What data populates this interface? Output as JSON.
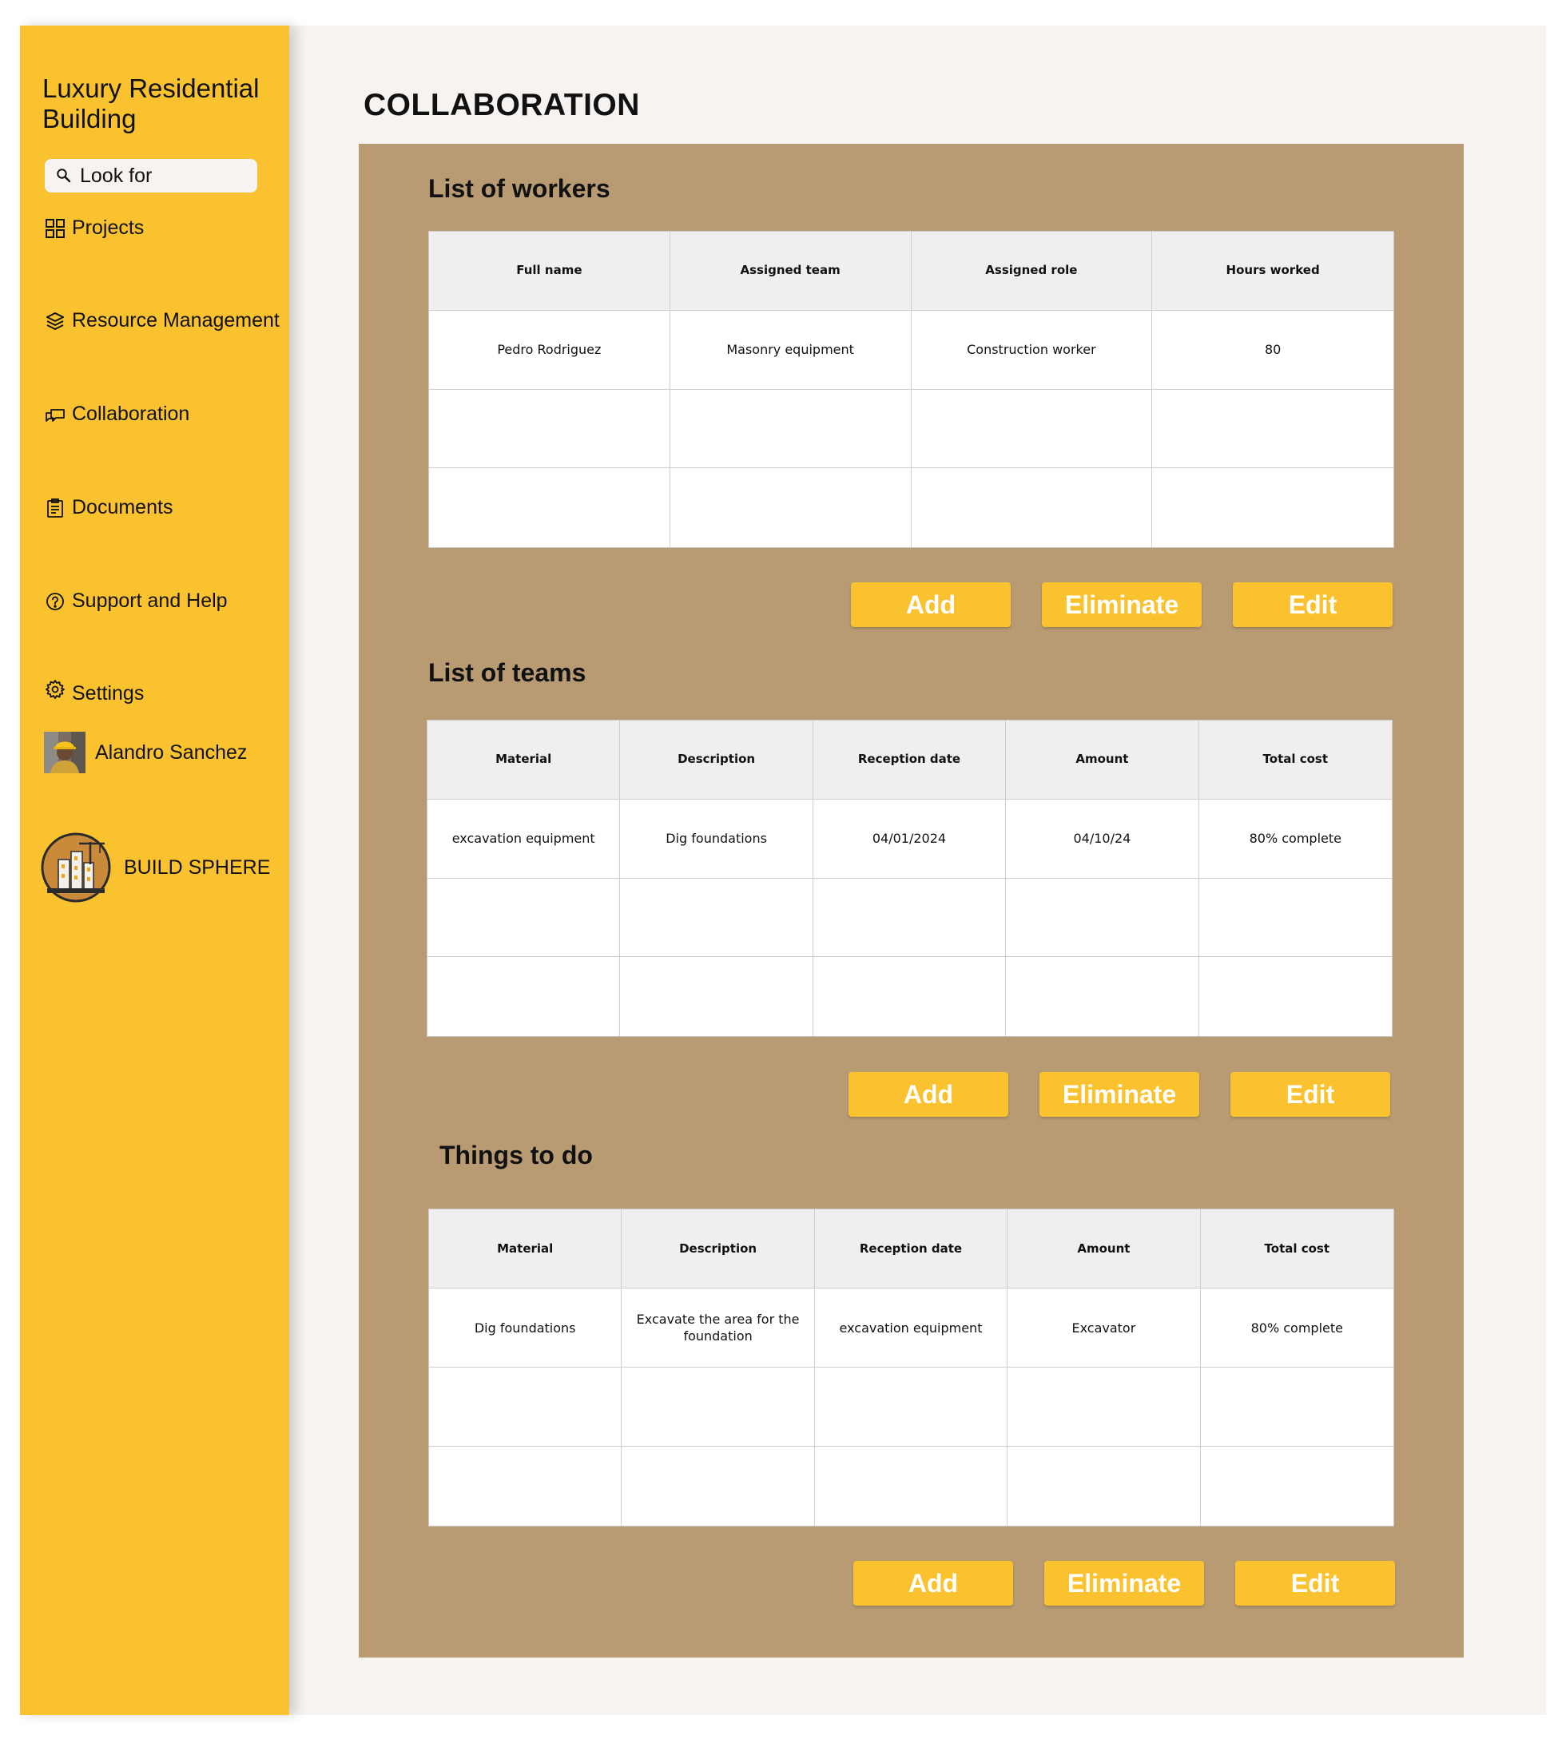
{
  "sidebar": {
    "project_title": "Luxury Residential Building",
    "search_placeholder": "Look for",
    "nav": [
      {
        "label": "Projects",
        "icon": "grid-icon"
      },
      {
        "label": "Resource Management",
        "icon": "layers-icon"
      },
      {
        "label": "Collaboration",
        "icon": "chat-icon"
      },
      {
        "label": "Documents",
        "icon": "clipboard-icon"
      },
      {
        "label": "Support and Help",
        "icon": "help-circle-icon"
      },
      {
        "label": "Settings",
        "icon": "gear-icon"
      }
    ],
    "user_name": "Alandro Sanchez",
    "brand_name": "BUILD SPHERE"
  },
  "page": {
    "title": "COLLABORATION"
  },
  "workers": {
    "title": "List of workers",
    "headers": [
      "Full name",
      "Assigned team",
      "Assigned role",
      "Hours worked"
    ],
    "rows": [
      [
        "Pedro Rodriguez",
        "Masonry equipment",
        "Construction worker",
        "80"
      ],
      [
        "",
        "",
        "",
        ""
      ],
      [
        "",
        "",
        "",
        ""
      ]
    ],
    "buttons": {
      "add": "Add",
      "eliminate": "Eliminate",
      "edit": "Edit"
    }
  },
  "teams": {
    "title": "List of teams",
    "headers": [
      "Material",
      "Description",
      "Reception date",
      "Amount",
      "Total cost"
    ],
    "rows": [
      [
        "excavation equipment",
        "Dig foundations",
        "04/01/2024",
        "04/10/24",
        "80% complete"
      ],
      [
        "",
        "",
        "",
        "",
        ""
      ],
      [
        "",
        "",
        "",
        "",
        ""
      ]
    ],
    "buttons": {
      "add": "Add",
      "eliminate": "Eliminate",
      "edit": "Edit"
    }
  },
  "todo": {
    "title": "Things to do",
    "headers": [
      "Material",
      "Description",
      "Reception date",
      "Amount",
      "Total cost"
    ],
    "rows": [
      [
        "Dig foundations",
        "Excavate the area for the foundation",
        "excavation equipment",
        "Excavator",
        "80% complete"
      ],
      [
        "",
        "",
        "",
        "",
        ""
      ],
      [
        "",
        "",
        "",
        "",
        ""
      ]
    ],
    "buttons": {
      "add": "Add",
      "eliminate": "Eliminate",
      "edit": "Edit"
    }
  },
  "colors": {
    "accent": "#fac22f",
    "panel": "#b89b73",
    "background": "#f6f3f1"
  }
}
